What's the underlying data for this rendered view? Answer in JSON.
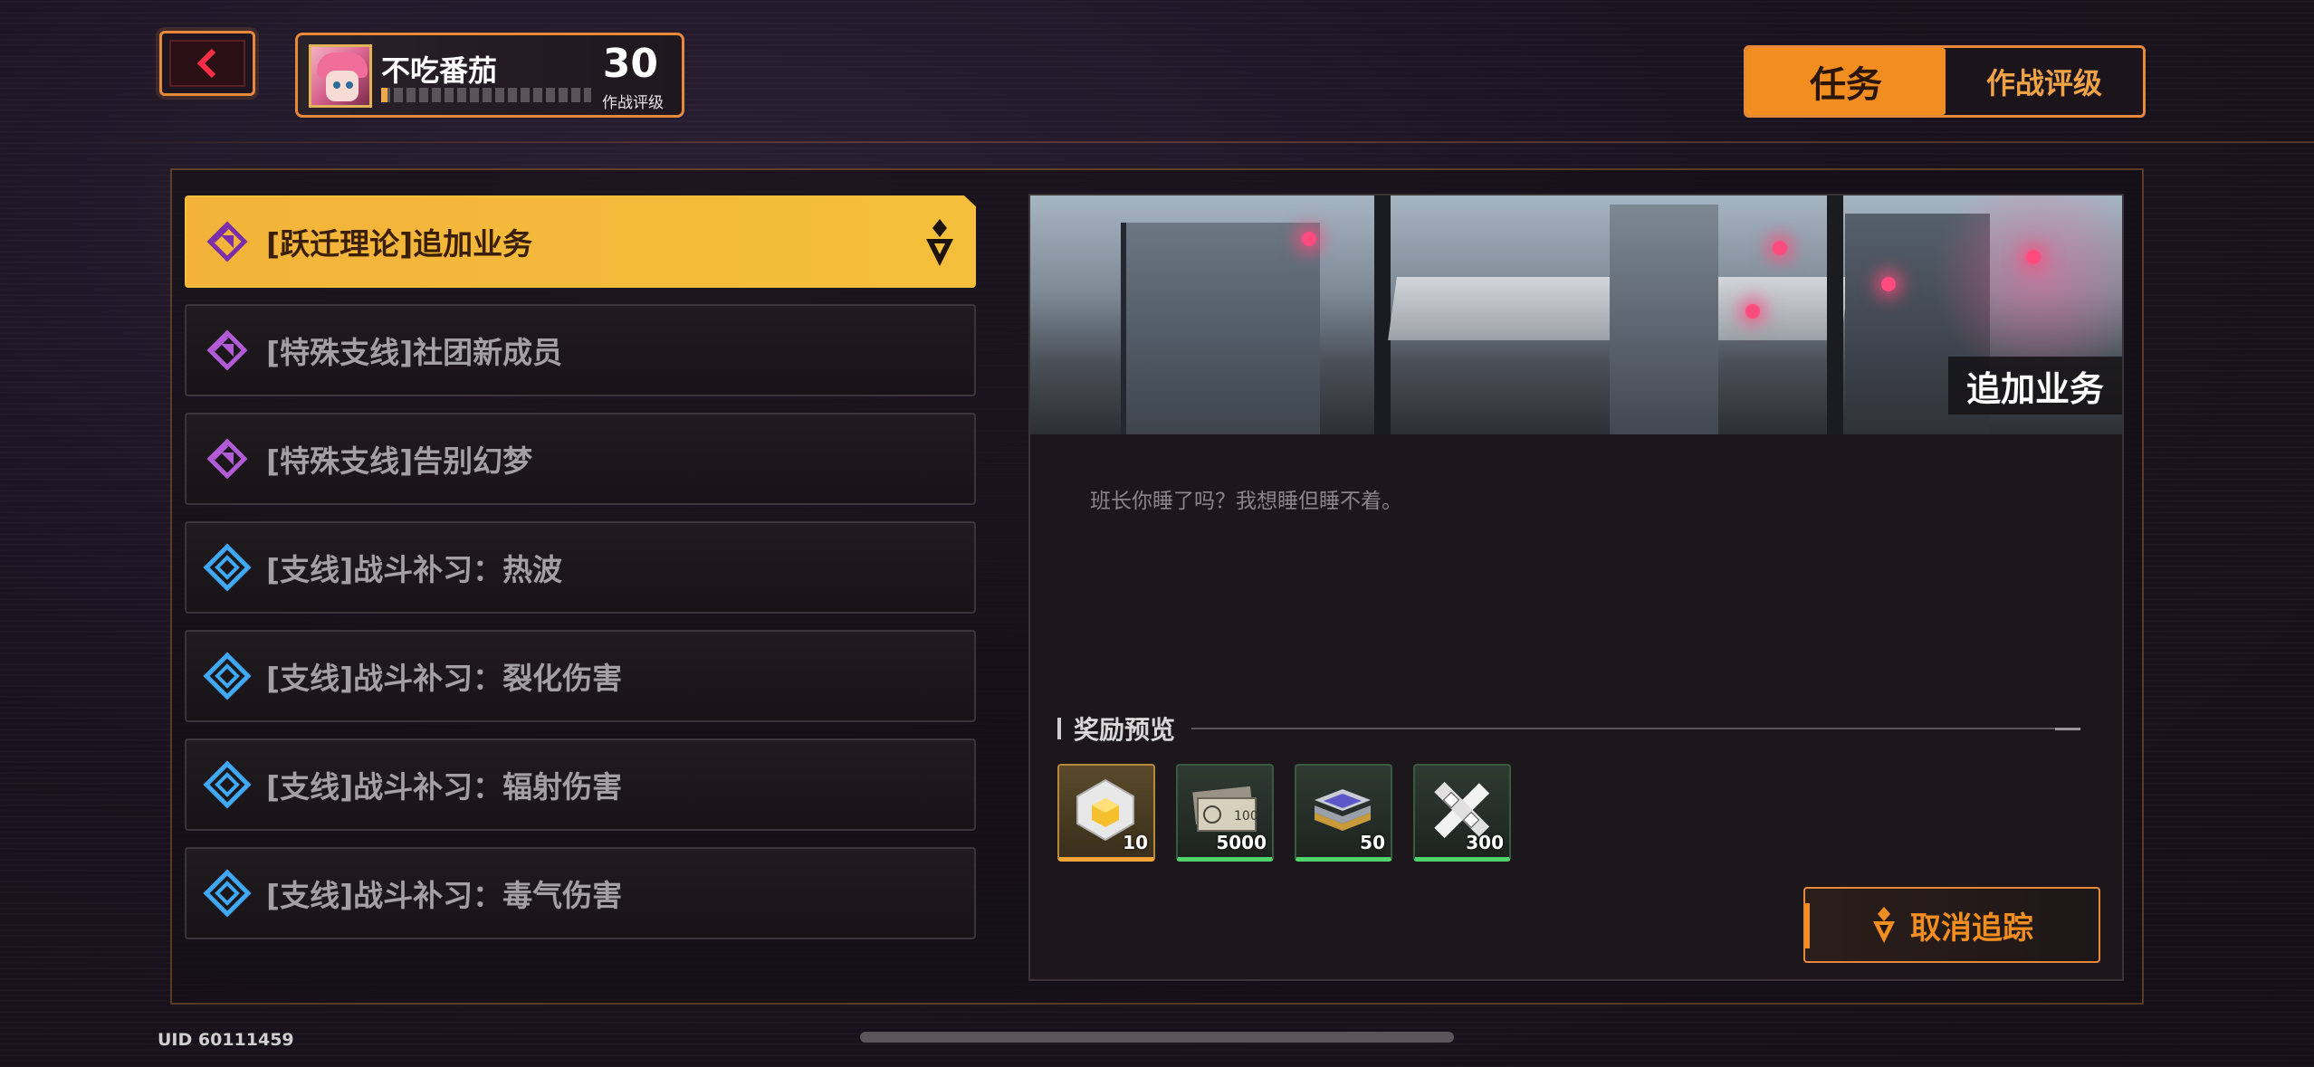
{
  "profile": {
    "name": "不吃番茄",
    "level": "30",
    "rank_label": "作战评级",
    "progress": 0.03
  },
  "tabs": [
    {
      "label": "任务",
      "active": true
    },
    {
      "label": "作战评级",
      "active": false
    }
  ],
  "missions": [
    {
      "label": "[跃迁理论]追加业务",
      "type": "main-purple",
      "active": true,
      "tracked": true
    },
    {
      "label": "[特殊支线]社团新成员",
      "type": "purple",
      "active": false
    },
    {
      "label": "[特殊支线]告别幻梦",
      "type": "purple",
      "active": false
    },
    {
      "label": "[支线]战斗补习：热波",
      "type": "blue",
      "active": false
    },
    {
      "label": "[支线]战斗补习：裂化伤害",
      "type": "blue",
      "active": false
    },
    {
      "label": "[支线]战斗补习：辐射伤害",
      "type": "blue",
      "active": false
    },
    {
      "label": "[支线]战斗补习：毒气伤害",
      "type": "blue",
      "active": false
    }
  ],
  "detail": {
    "banner_title": "追加业务",
    "description": "班长你睡了吗？我想睡但睡不着。",
    "reward_title": "奖励预览",
    "rewards": [
      {
        "icon": "cube-crystal-icon",
        "count": "10",
        "rarity": "gold"
      },
      {
        "icon": "cash-bills-icon",
        "count": "5000",
        "rarity": "green"
      },
      {
        "icon": "chip-stack-icon",
        "count": "50",
        "rarity": "green"
      },
      {
        "icon": "wrench-parts-icon",
        "count": "300",
        "rarity": "green"
      }
    ],
    "untrack_label": "取消追踪"
  },
  "footer": {
    "uid": "UID 60111459"
  },
  "colors": {
    "accent": "#f28d1f",
    "active_item": "#f5bf3b",
    "purple_icon": "#b15bd9",
    "blue_icon": "#3fa9f5"
  }
}
